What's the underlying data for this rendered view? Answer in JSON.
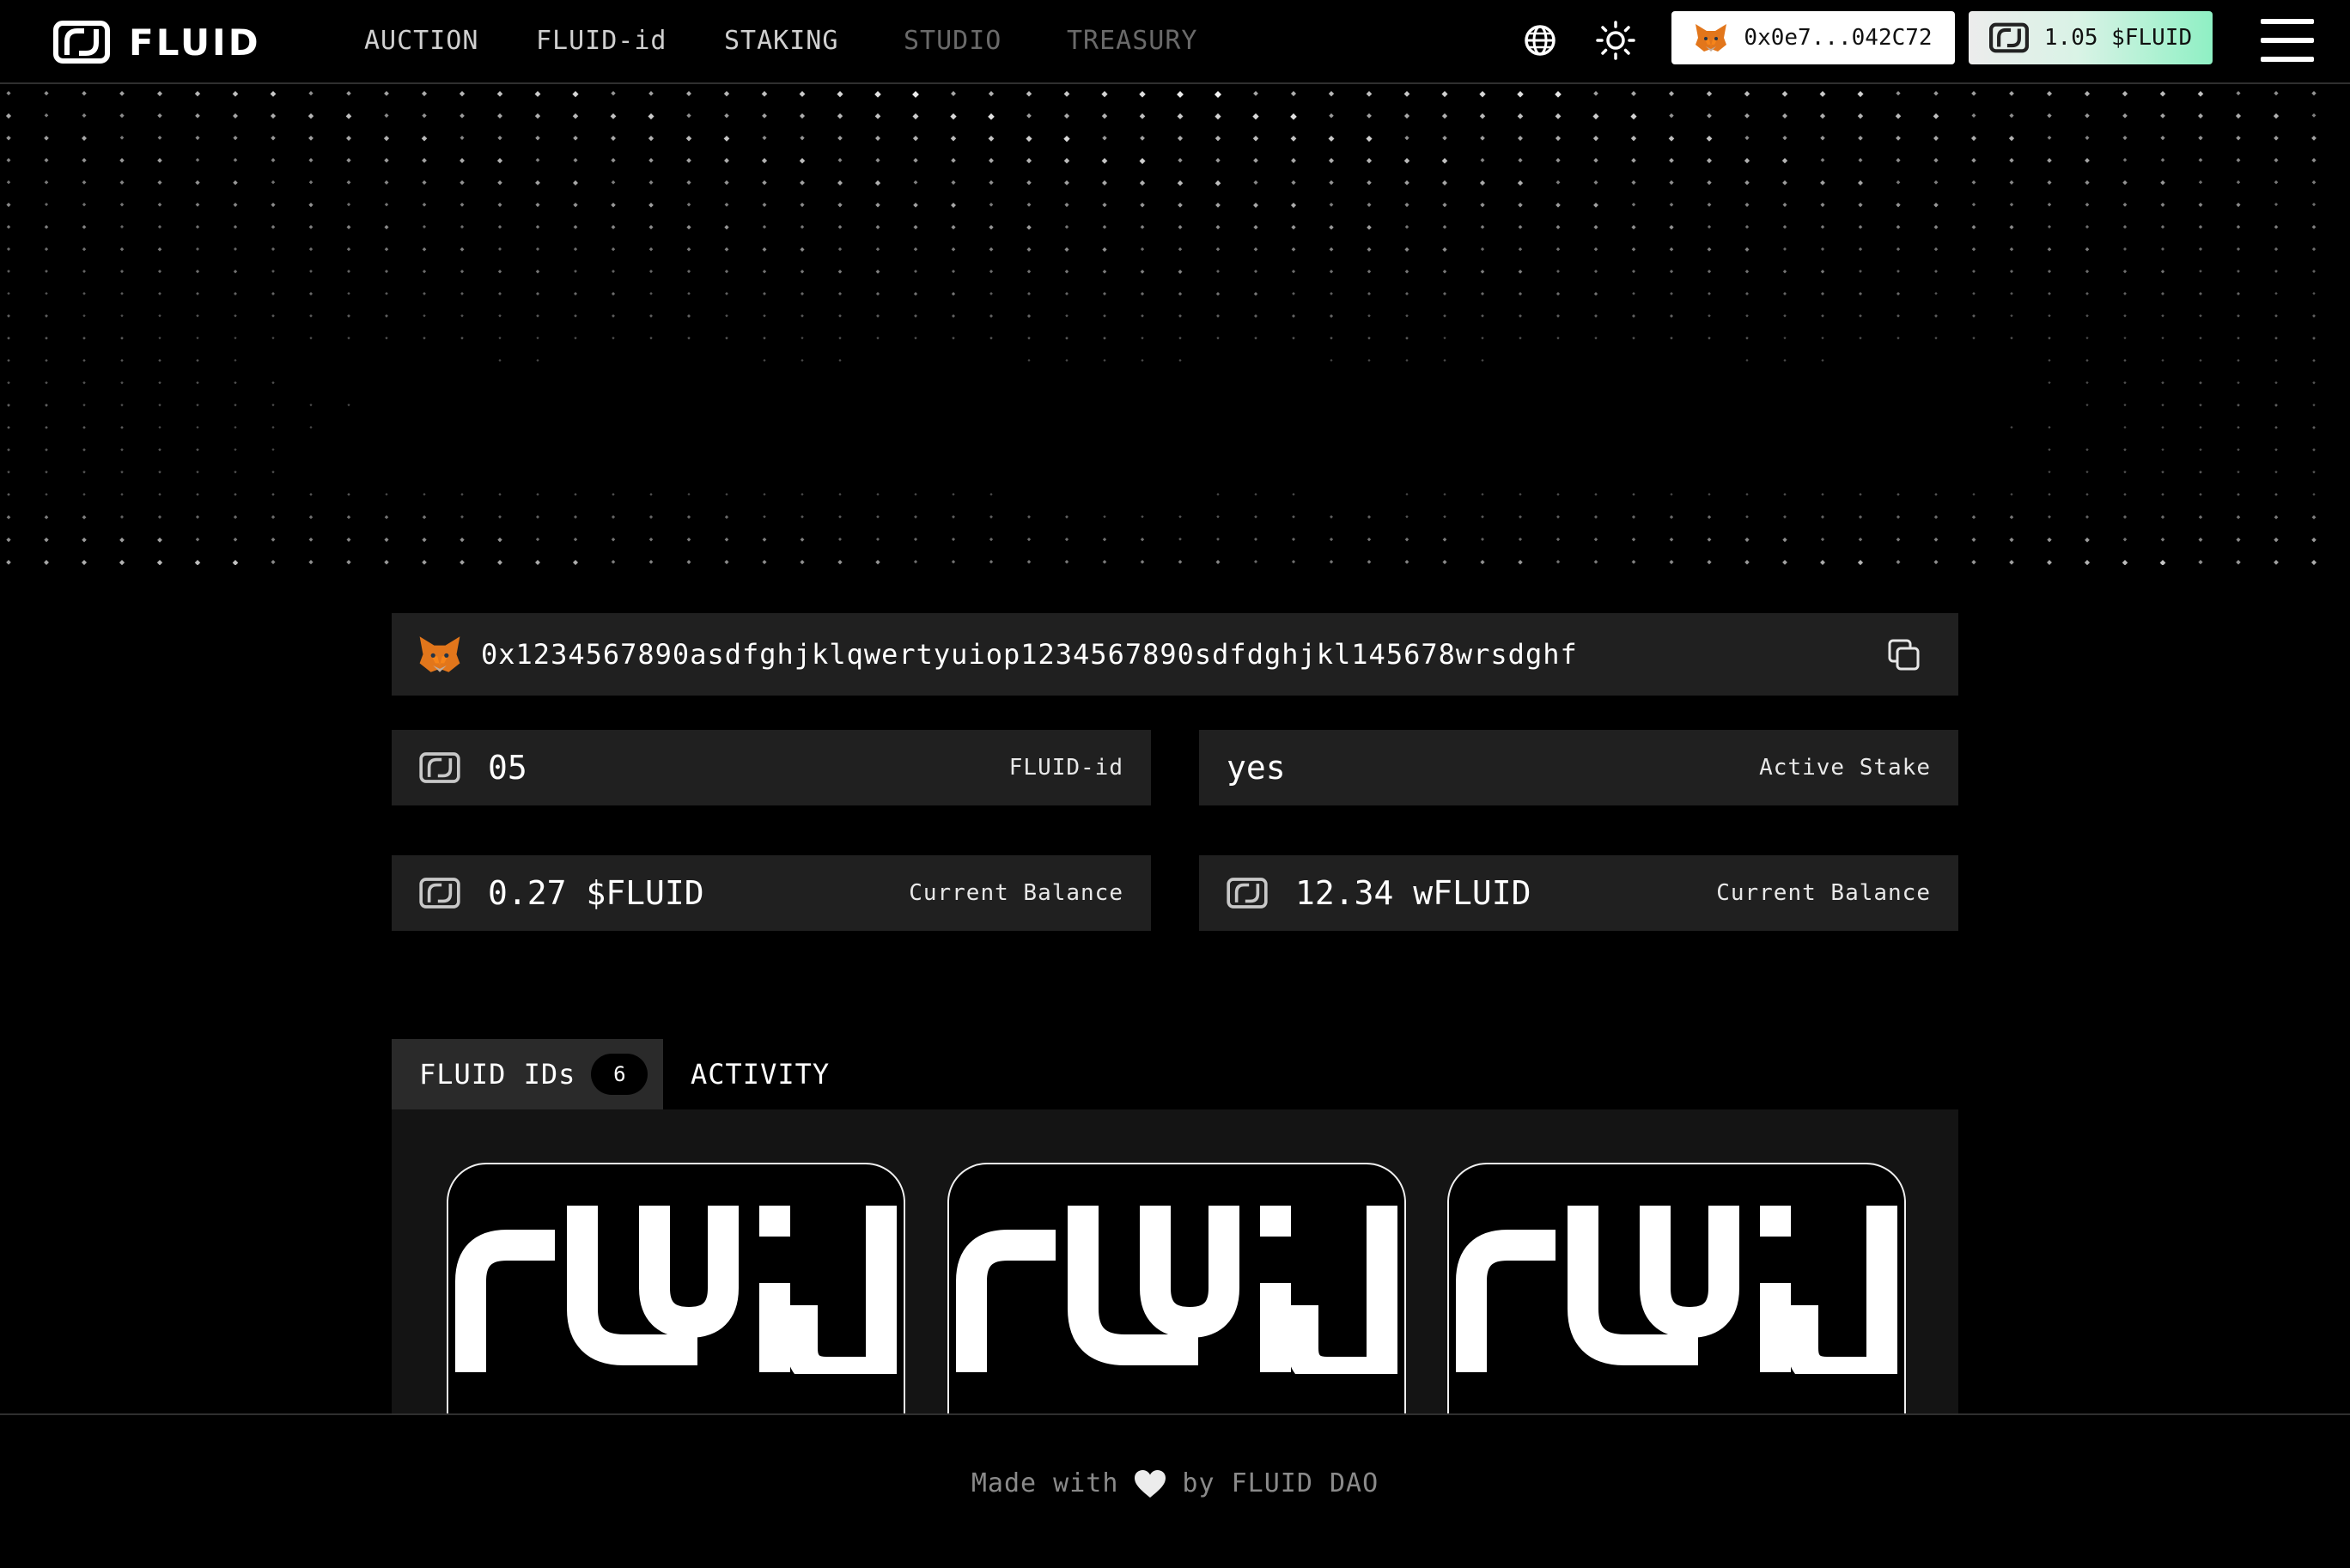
{
  "header": {
    "brand": "FLUID",
    "nav": [
      {
        "label": "AUCTION",
        "state": "active"
      },
      {
        "label": "FLUID-id",
        "state": "active"
      },
      {
        "label": "STAKING",
        "state": "active"
      },
      {
        "label": "STUDIO",
        "state": "disabled"
      },
      {
        "label": "TREASURY",
        "state": "disabled"
      }
    ],
    "wallet_label": "0x0e7...042C72",
    "balance_label": "1.05 $FLUID",
    "icons": {
      "language": "globe-icon",
      "theme": "sun-icon",
      "menu": "hamburger-icon",
      "wallet": "metamask-fox-icon"
    }
  },
  "profile": {
    "address": "0x1234567890asdfghjklqwertyuiop1234567890sdfdghjkl145678wrsdghf",
    "stats": [
      {
        "value": "05",
        "label": "FLUID-id"
      },
      {
        "value": "yes",
        "label": "Active Stake"
      },
      {
        "value": "0.27 $FLUID",
        "label": "Current Balance"
      },
      {
        "value": "12.34 wFLUID",
        "label": "Current Balance"
      }
    ]
  },
  "tabs": {
    "ids_label": "FLUID IDs",
    "ids_count": "6",
    "activity_label": "ACTIVITY"
  },
  "cards": [
    {
      "logo": "fluid-id-logo"
    },
    {
      "logo": "fluid-id-logo"
    },
    {
      "logo": "fluid-id-logo"
    }
  ],
  "footer": {
    "prefix": "Made with",
    "suffix": "by FLUID DAO"
  },
  "colors": {
    "background": "#000000",
    "card": "#202020",
    "panel": "#141414",
    "balance_gradient_end": "#8ff0c4",
    "fox_orange": "#e2761b"
  }
}
